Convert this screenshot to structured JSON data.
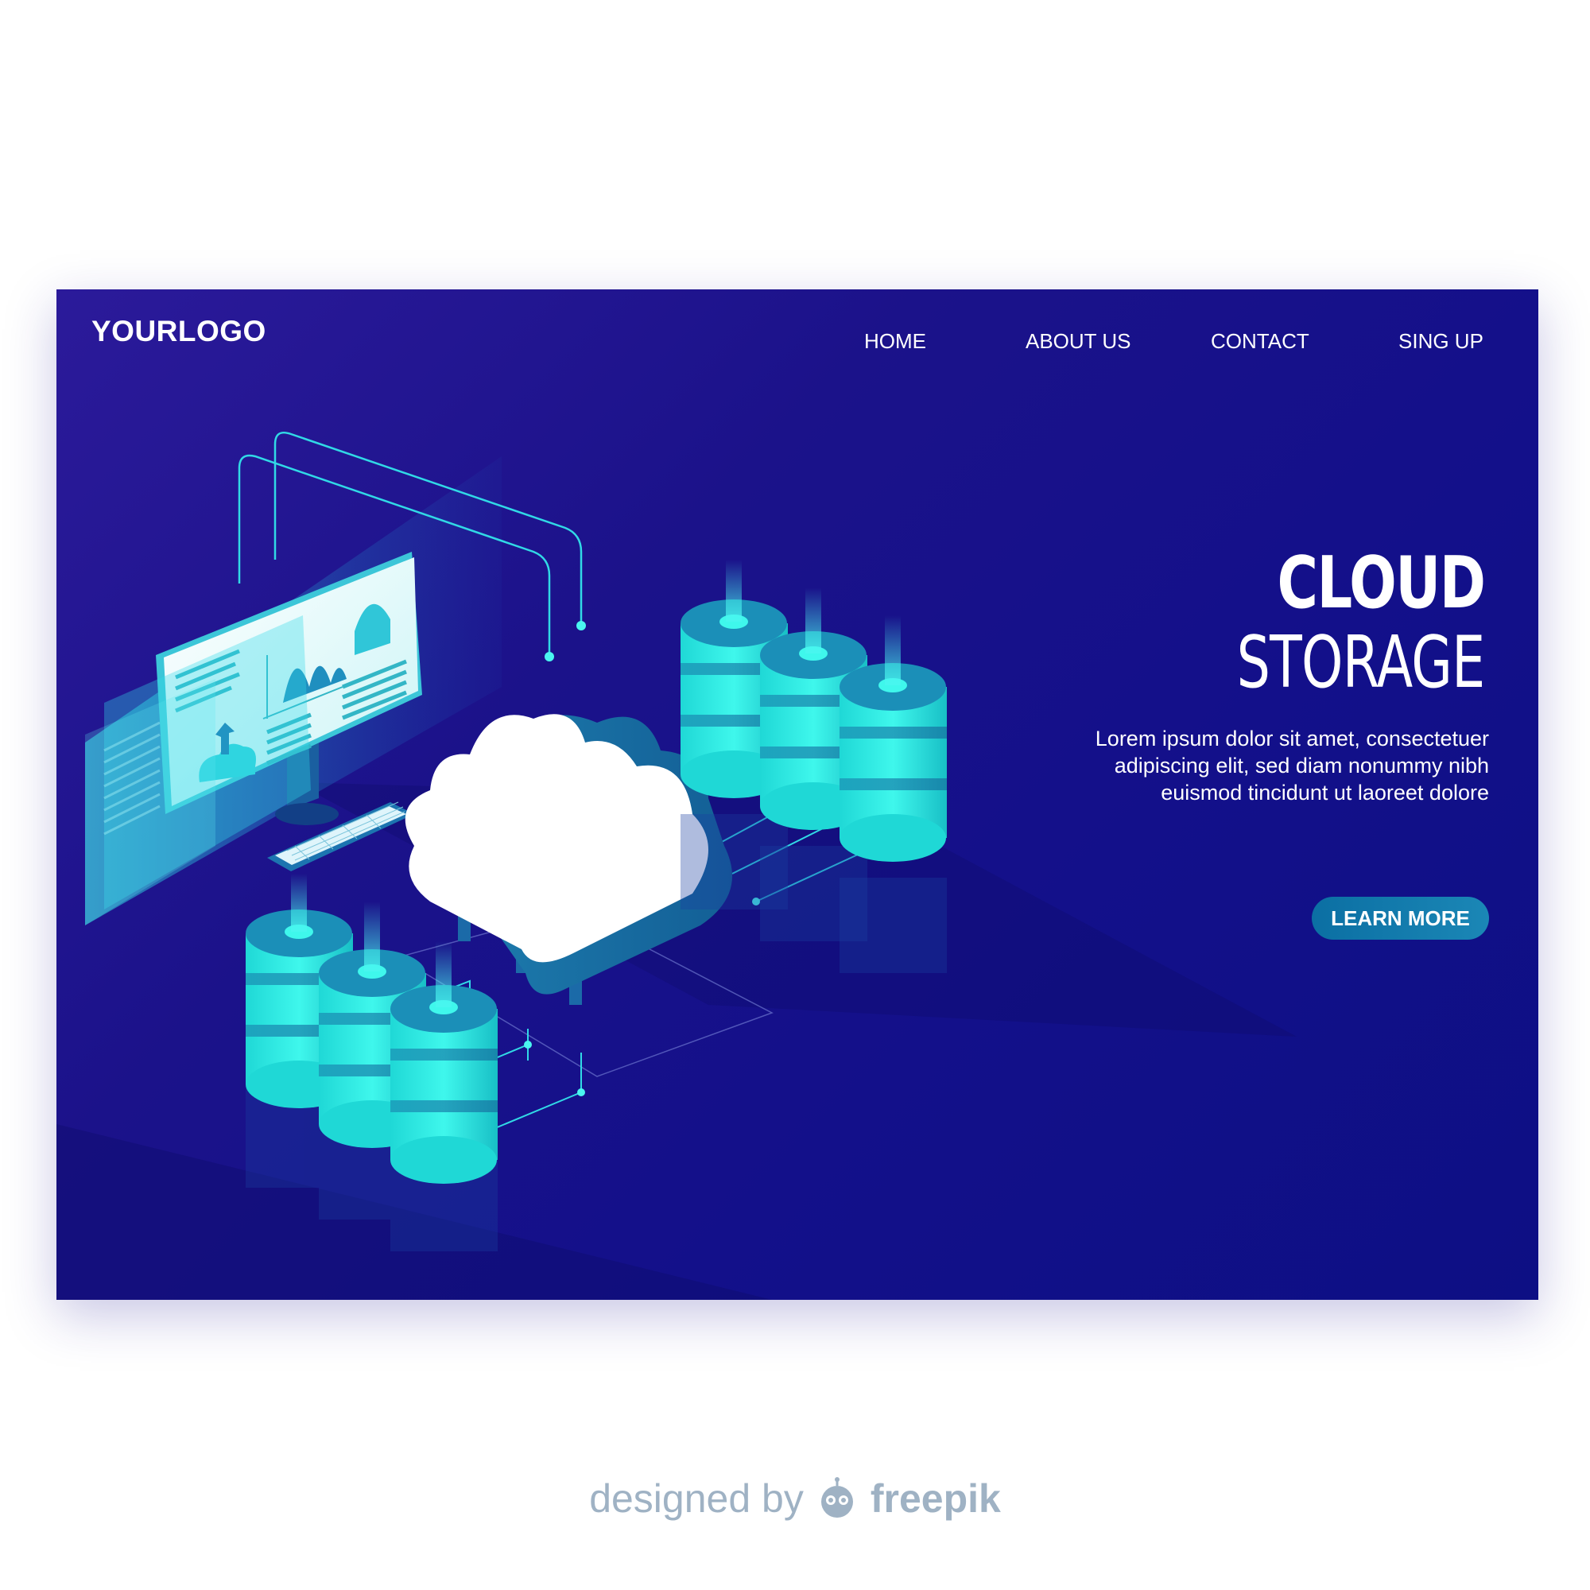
{
  "header": {
    "logo": "YOURLOGO",
    "nav": [
      {
        "label": "HOME"
      },
      {
        "label": "ABOUT US"
      },
      {
        "label": "CONTACT"
      },
      {
        "label": "SING UP"
      }
    ]
  },
  "hero": {
    "title_line1": "CLOUD",
    "title_line2": "STORAGE",
    "body_lines": [
      "Lorem ipsum dolor sit amet, consectetuer",
      "adipiscing elit, sed diam nonummy nibh",
      "euismod tincidunt ut laoreet dolore"
    ],
    "cta_label": "LEARN MORE"
  },
  "footer": {
    "credit_prefix": "designed by",
    "credit_brand": "freepik"
  },
  "colors": {
    "background_top": "#2b1a9a",
    "background_bottom": "#0d0f84",
    "accent_cyan": "#2ef2e6",
    "button": "#0b6fa3",
    "credit_gray": "#9fb2c4"
  },
  "icons": [
    "cloud-icon",
    "database-icon",
    "monitor-icon",
    "keyboard-icon",
    "upload-icon",
    "freepik-mascot-icon"
  ]
}
